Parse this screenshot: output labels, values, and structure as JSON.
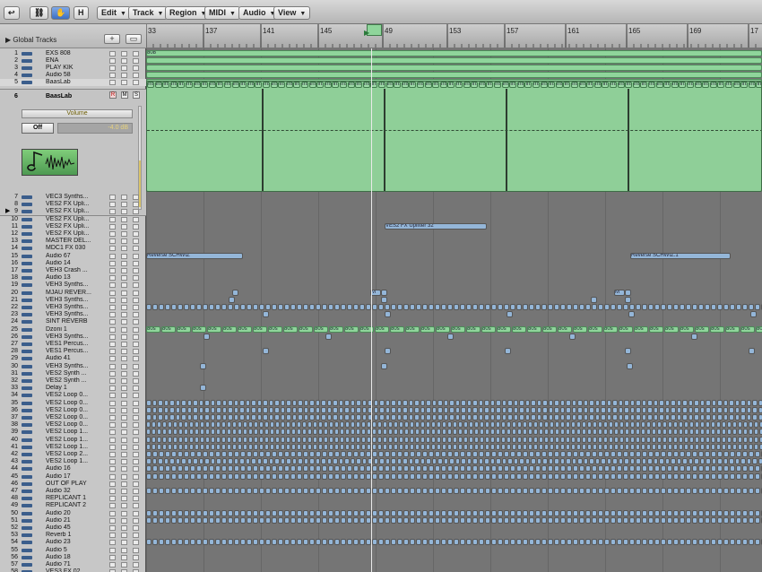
{
  "toolbar": {
    "buttons": [
      {
        "name": "back-button",
        "label": "↩"
      },
      {
        "name": "link-button",
        "label": "⛓"
      },
      {
        "name": "pointer-tool-button",
        "label": "✋"
      },
      {
        "name": "h-button",
        "label": "H"
      }
    ],
    "menus": [
      "Edit",
      "Track",
      "Region",
      "MIDI",
      "Audio",
      "View"
    ]
  },
  "global_tracks": {
    "label": "Global Tracks",
    "add": "+",
    "options": "▭"
  },
  "ruler": {
    "bars": [
      "33",
      "137",
      "141",
      "145",
      "49",
      "153",
      "157",
      "161",
      "165",
      "169",
      "17"
    ]
  },
  "inspector": {
    "number": "6",
    "name": "BaasLab",
    "rec": "R",
    "mute": "M",
    "solo": "S",
    "param": "Volume",
    "off": "Off",
    "db": "-4.0 dB"
  },
  "tracks_top": [
    {
      "n": "1",
      "name": "EXS 808"
    },
    {
      "n": "2",
      "name": "ENA"
    },
    {
      "n": "3",
      "name": "PLAY KIK"
    },
    {
      "n": "4",
      "name": "Audio 58"
    },
    {
      "n": "5",
      "name": "BaasLab"
    }
  ],
  "tracks": [
    {
      "n": "7",
      "name": "VEC3 Synths..."
    },
    {
      "n": "8",
      "name": "VES2 FX Upli..."
    },
    {
      "n": "9",
      "name": "VES2 FX Upli..."
    },
    {
      "n": "10",
      "name": "VES2 FX Upli..."
    },
    {
      "n": "11",
      "name": "VES2 FX Upli..."
    },
    {
      "n": "12",
      "name": "VES2 FX Upli..."
    },
    {
      "n": "13",
      "name": "MASTER DEL..."
    },
    {
      "n": "14",
      "name": "MDC1 FX 030"
    },
    {
      "n": "15",
      "name": "Audio 67"
    },
    {
      "n": "16",
      "name": "Audio 14"
    },
    {
      "n": "17",
      "name": "VEH3 Crash ..."
    },
    {
      "n": "18",
      "name": "Audio 13"
    },
    {
      "n": "19",
      "name": "VEH3 Synths..."
    },
    {
      "n": "20",
      "name": "MJAU REVER..."
    },
    {
      "n": "21",
      "name": "VEH3 Synths..."
    },
    {
      "n": "22",
      "name": "VEH3 Synths..."
    },
    {
      "n": "23",
      "name": "VEH3 Synths..."
    },
    {
      "n": "24",
      "name": "SINT REVERB"
    },
    {
      "n": "25",
      "name": "Dzoni 1"
    },
    {
      "n": "26",
      "name": "VEH3 Synths..."
    },
    {
      "n": "27",
      "name": "VES1 Percus..."
    },
    {
      "n": "28",
      "name": "VES1 Percus..."
    },
    {
      "n": "29",
      "name": "Audio 41"
    },
    {
      "n": "30",
      "name": "VEH3 Synths..."
    },
    {
      "n": "31",
      "name": "VES2 Synth ..."
    },
    {
      "n": "32",
      "name": "VES2 Synth ..."
    },
    {
      "n": "33",
      "name": "Delay 1"
    },
    {
      "n": "34",
      "name": "VES2 Loop 0..."
    },
    {
      "n": "35",
      "name": "VES2 Loop 0..."
    },
    {
      "n": "36",
      "name": "VES2 Loop 0..."
    },
    {
      "n": "37",
      "name": "VES2 Loop 0..."
    },
    {
      "n": "38",
      "name": "VES2 Loop 0..."
    },
    {
      "n": "39",
      "name": "VES2 Loop 1..."
    },
    {
      "n": "40",
      "name": "VES2 Loop 1..."
    },
    {
      "n": "41",
      "name": "VES2 Loop 1..."
    },
    {
      "n": "42",
      "name": "VES2 Loop 2..."
    },
    {
      "n": "43",
      "name": "VES2 Loop 1..."
    },
    {
      "n": "44",
      "name": "Audio 16"
    },
    {
      "n": "45",
      "name": "Audio 17"
    },
    {
      "n": "46",
      "name": "OUT OF PLAY"
    },
    {
      "n": "47",
      "name": "Audio 32"
    },
    {
      "n": "48",
      "name": "REPLICANT 1"
    },
    {
      "n": "49",
      "name": "REPLICANT 2"
    },
    {
      "n": "50",
      "name": "Audio 20"
    },
    {
      "n": "51",
      "name": "Audio 21"
    },
    {
      "n": "52",
      "name": "Audio 45"
    },
    {
      "n": "53",
      "name": "Reverb 1"
    },
    {
      "n": "54",
      "name": "Audio 23"
    },
    {
      "n": "55",
      "name": "Audio 5"
    },
    {
      "n": "56",
      "name": "Audio 18"
    },
    {
      "n": "57",
      "name": "Audio 71"
    },
    {
      "n": "58",
      "name": "VES3 FX 02"
    }
  ],
  "region_labels": {
    "exs": "808",
    "inst": "Inst",
    "uplifter": "VES2 FX Uplifter 32",
    "reverse_a": "Reverse SCHWIZ",
    "reverse_b": "Reverse SCHWIZ.1",
    "mark": "M",
    "dzoni": "80s"
  },
  "colors": {
    "green": "#8fd59b",
    "blue": "#94b6d8",
    "lane": "#757575",
    "select": "#d8d8d8"
  }
}
